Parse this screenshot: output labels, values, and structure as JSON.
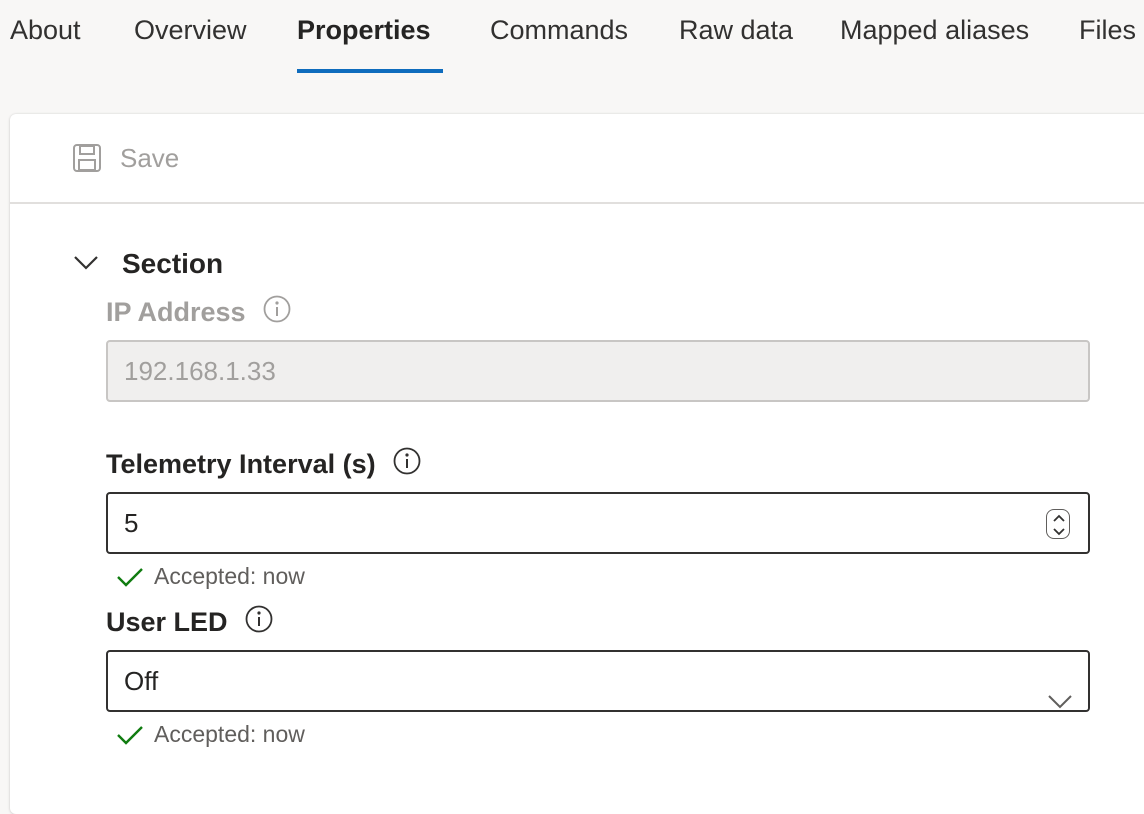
{
  "tabs": [
    {
      "label": "About",
      "active": false
    },
    {
      "label": "Overview",
      "active": false
    },
    {
      "label": "Properties",
      "active": true
    },
    {
      "label": "Commands",
      "active": false
    },
    {
      "label": "Raw data",
      "active": false
    },
    {
      "label": "Mapped aliases",
      "active": false
    },
    {
      "label": "Files",
      "active": false
    }
  ],
  "toolbar": {
    "save_label": "Save",
    "save_icon": "save-icon",
    "save_enabled": false
  },
  "section": {
    "title": "Section",
    "expanded": true,
    "icon": "chevron-down-icon"
  },
  "fields": {
    "ip_address": {
      "label": "IP Address",
      "value": "192.168.1.33",
      "disabled": true
    },
    "telemetry_interval": {
      "label": "Telemetry Interval (s)",
      "value": "5",
      "status": "Accepted: now"
    },
    "user_led": {
      "label": "User LED",
      "value": "Off",
      "status": "Accepted: now"
    }
  },
  "colors": {
    "accent": "#0f6cbd",
    "success": "#107c10",
    "disabled_text": "#a19f9d"
  }
}
